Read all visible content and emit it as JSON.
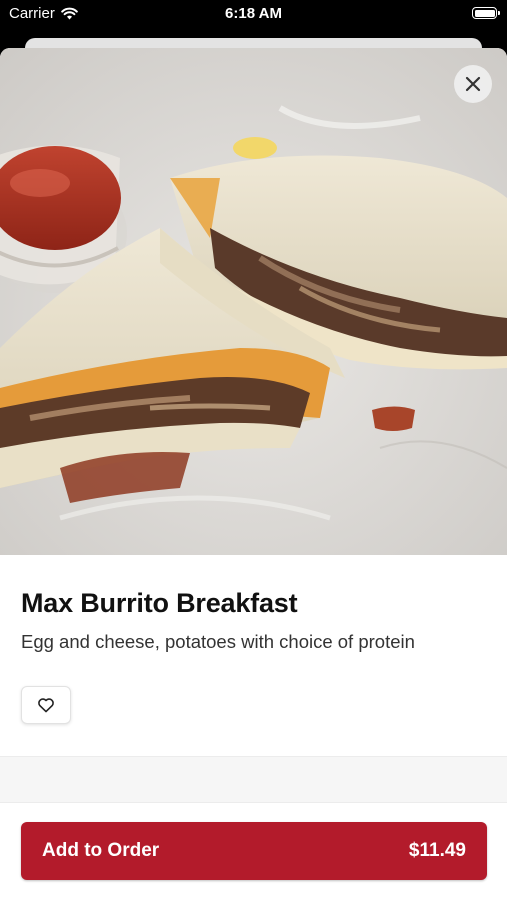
{
  "status_bar": {
    "carrier": "Carrier",
    "time": "6:18 AM"
  },
  "item": {
    "title": "Max Burrito Breakfast",
    "description": "Egg and cheese, potatoes with choice of protein"
  },
  "actions": {
    "add_label": "Add to Order",
    "price": "$11.49"
  },
  "icons": {
    "close": "close-icon",
    "favorite": "heart-icon",
    "wifi": "wifi-icon",
    "battery": "battery-icon"
  },
  "colors": {
    "brand_red": "#b31b2b",
    "title_text": "#111111",
    "body_text": "#333333"
  }
}
